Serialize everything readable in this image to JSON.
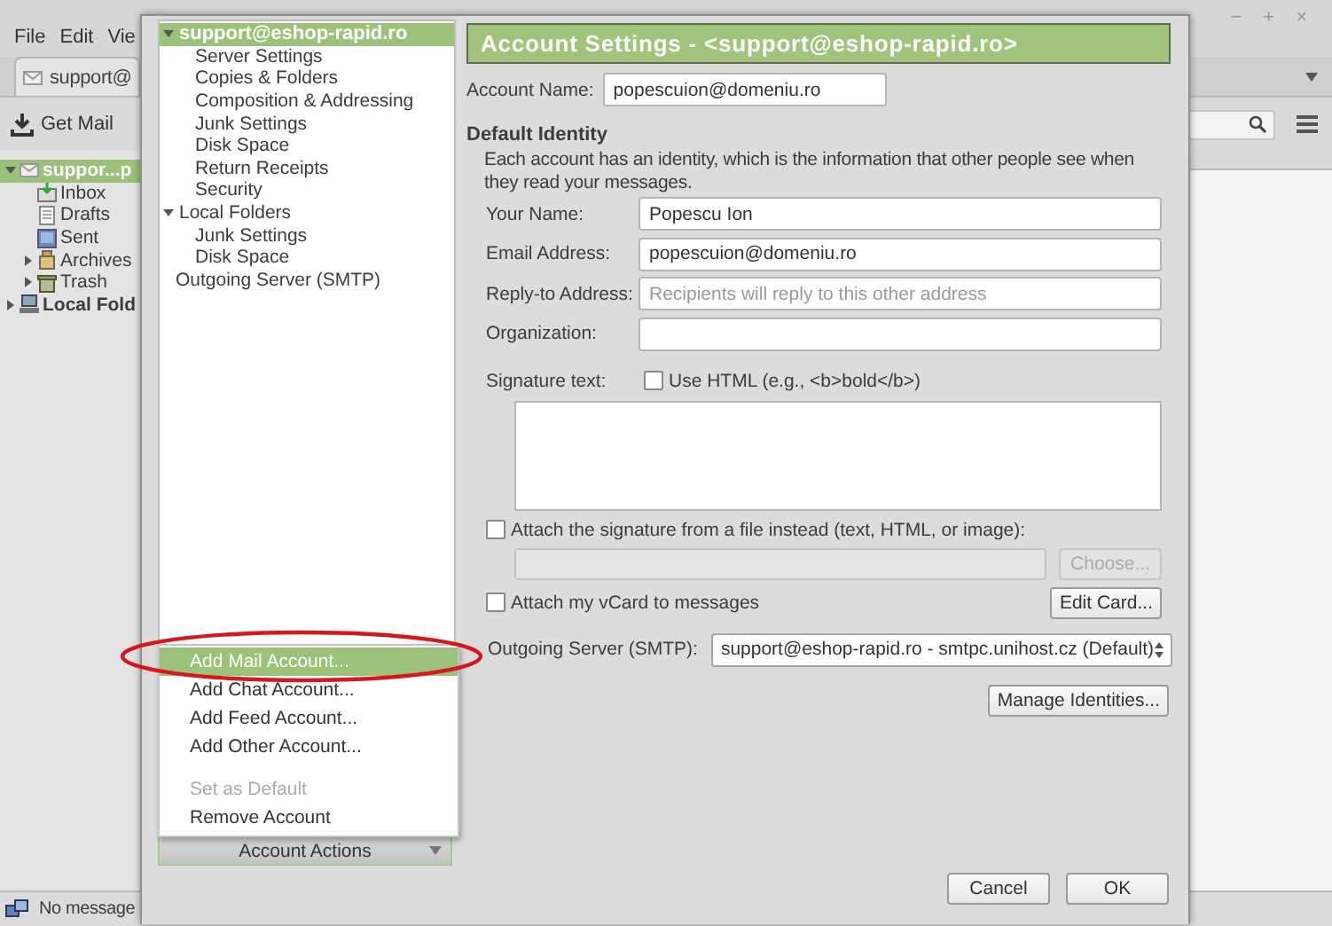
{
  "main_window": {
    "menu": [
      "File",
      "Edit",
      "Vie"
    ],
    "window_controls": [
      "−",
      "+",
      "×"
    ],
    "tab": "support@",
    "toolbar_button": "Get Mail",
    "folders": [
      {
        "label": "suppor...p",
        "kind": "account",
        "bold": true,
        "selected": true,
        "expanded": true,
        "children": [
          {
            "label": "Inbox",
            "kind": "inbox",
            "bold": false,
            "selected": false
          },
          {
            "label": "Drafts",
            "kind": "drafts",
            "bold": false,
            "selected": false
          },
          {
            "label": "Sent",
            "kind": "sent",
            "bold": false,
            "selected": false
          },
          {
            "label": "Archives",
            "kind": "archives",
            "bold": false,
            "selected": false,
            "expanded": false
          },
          {
            "label": "Trash",
            "kind": "trash",
            "bold": false,
            "selected": false,
            "expanded": false
          }
        ]
      },
      {
        "label": "Local Fold",
        "kind": "local",
        "bold": true,
        "selected": false,
        "expanded": false
      }
    ],
    "status_bar": "No message"
  },
  "dialog": {
    "tree": [
      {
        "label": "support@eshop-rapid.ro",
        "selected": true,
        "expanded": true,
        "children": [
          {
            "label": "Server Settings",
            "selected": false
          },
          {
            "label": "Copies & Folders",
            "selected": false
          },
          {
            "label": "Composition & Addressing",
            "selected": false
          },
          {
            "label": "Junk Settings",
            "selected": false
          },
          {
            "label": "Disk Space",
            "selected": false
          },
          {
            "label": "Return Receipts",
            "selected": false
          },
          {
            "label": "Security",
            "selected": false
          }
        ]
      },
      {
        "label": "Local Folders",
        "selected": false,
        "expanded": true,
        "children": [
          {
            "label": "Junk Settings",
            "selected": false
          },
          {
            "label": "Disk Space",
            "selected": false
          }
        ]
      },
      {
        "label": "Outgoing Server (SMTP)",
        "selected": false
      }
    ],
    "account_actions_menu": [
      {
        "kind": "item",
        "label": "Add Mail Account...",
        "selected": true,
        "disabled": false
      },
      {
        "kind": "item",
        "label": "Add Chat Account...",
        "selected": false,
        "disabled": false
      },
      {
        "kind": "item",
        "label": "Add Feed Account...",
        "selected": false,
        "disabled": false
      },
      {
        "kind": "item",
        "label": "Add Other Account...",
        "selected": false,
        "disabled": false
      },
      {
        "kind": "separator"
      },
      {
        "kind": "item",
        "label": "Set as Default",
        "selected": false,
        "disabled": true
      },
      {
        "kind": "item",
        "label": "Remove Account",
        "selected": false,
        "disabled": false
      }
    ],
    "account_actions": "Account Actions",
    "header": "Account Settings - <support@eshop-rapid.ro>",
    "account_name": {
      "label": "Account Name:",
      "value": "popescuion@domeniu.ro"
    },
    "identity_heading": "Default Identity",
    "identity_description": "Each account has an identity, which is the information that other people see when they read your messages.",
    "fields": [
      {
        "label": "Your Name:",
        "value": "Popescu Ion"
      },
      {
        "label": "Email Address:",
        "value": "popescuion@domeniu.ro"
      },
      {
        "label": "Reply-to Address:",
        "placeholder": "Recipients will reply to this other address"
      },
      {
        "label": "Organization:"
      }
    ],
    "signature_label": "Signature text:",
    "use_html": {
      "label": "Use HTML (e.g., <b>bold</b>)",
      "checked": false
    },
    "attach_file": {
      "label": "Attach the signature from a file instead (text, HTML, or image):",
      "checked": false
    },
    "choose_button": {
      "label": "Choose...",
      "disabled": true
    },
    "vcard": {
      "label": "Attach my vCard to messages",
      "checked": false
    },
    "edit_card_button": "Edit Card...",
    "smtp": {
      "label": "Outgoing Server (SMTP):",
      "value": "support@eshop-rapid.ro - smtpc.unihost.cz (Default)"
    },
    "manage_button": "Manage Identities...",
    "buttons": [
      "Cancel",
      "OK"
    ]
  }
}
